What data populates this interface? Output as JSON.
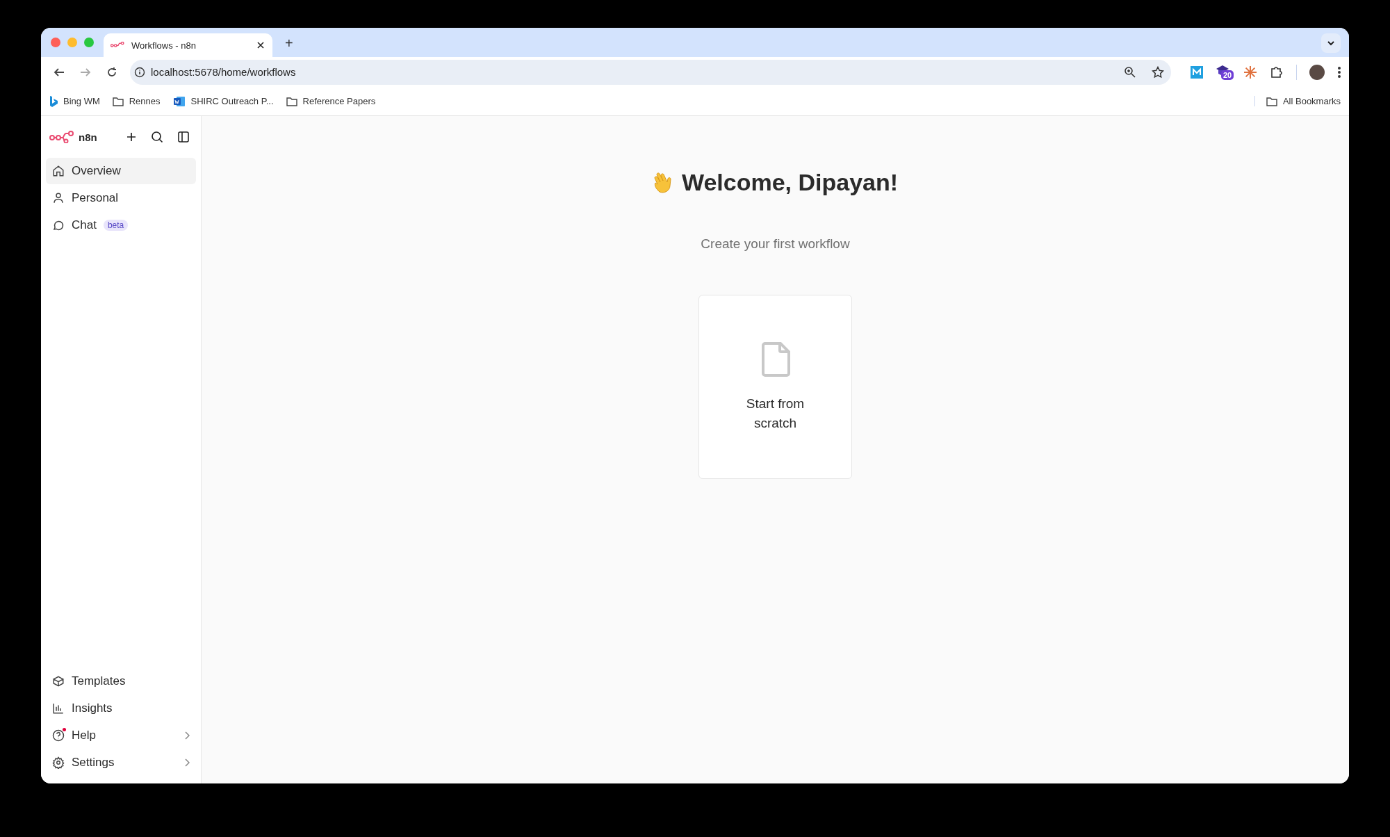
{
  "browser": {
    "tabs": [
      {
        "title": "Workflows - n8n",
        "selected": true
      }
    ],
    "address": "localhost:5678/home/workflows",
    "new_tab": "+",
    "extension_badge": "20",
    "bookmarks": [
      {
        "kind": "site",
        "label": "Bing WM"
      },
      {
        "kind": "folder",
        "label": "Rennes"
      },
      {
        "kind": "doc",
        "label": "SHIRC Outreach P..."
      },
      {
        "kind": "folder",
        "label": "Reference Papers"
      }
    ],
    "all_bookmarks": "All Bookmarks"
  },
  "sidebar": {
    "logo": "n8n",
    "top_items": [
      {
        "label": "Overview",
        "selected": true
      },
      {
        "label": "Personal",
        "selected": false
      },
      {
        "label": "Chat",
        "badge": "beta",
        "selected": false
      }
    ],
    "bottom_items": [
      {
        "label": "Templates",
        "selected": false,
        "submenu": false,
        "notification": false
      },
      {
        "label": "Insights",
        "selected": false,
        "submenu": false,
        "notification": false
      },
      {
        "label": "Help",
        "selected": false,
        "submenu": true,
        "notification": true
      },
      {
        "label": "Settings",
        "selected": false,
        "submenu": true,
        "notification": false
      }
    ]
  },
  "main": {
    "heading": "Welcome, Dipayan!",
    "subtitle": "Create your first workflow",
    "card": "Start from scratch"
  }
}
